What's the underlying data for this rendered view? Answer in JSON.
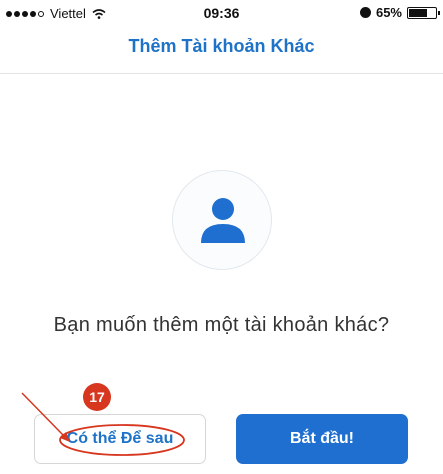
{
  "status_bar": {
    "carrier": "Viettel",
    "time": "09:36",
    "battery": "65%"
  },
  "nav": {
    "title": "Thêm Tài khoản Khác"
  },
  "prompt": "Bạn muốn thêm một tài khoản khác?",
  "buttons": {
    "later": "Có thể Để sau",
    "start": "Bắt đầu!"
  },
  "annotation": {
    "step": "17"
  },
  "colors": {
    "accent": "#1e73c8",
    "primary_button": "#1f6fd1",
    "annotation_red": "#d7361f"
  }
}
